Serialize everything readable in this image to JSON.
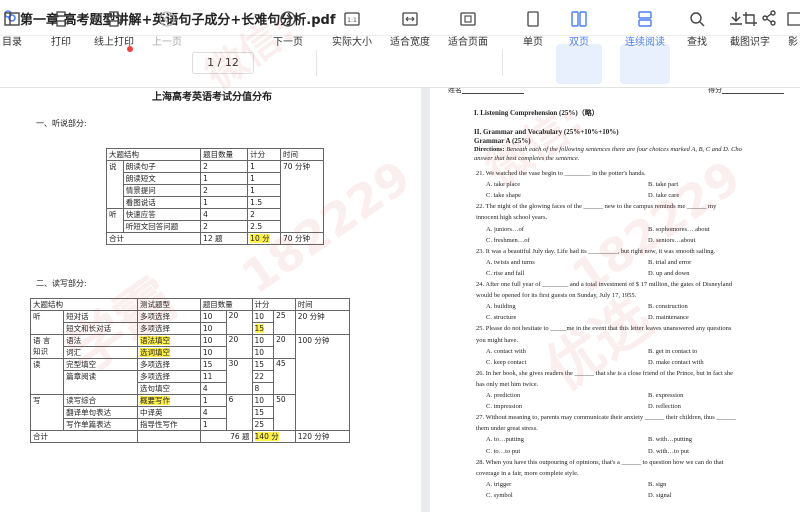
{
  "window": {
    "title": "第一章 高考题型讲解+英语句子成分+长难句分析.pdf"
  },
  "toolbar": {
    "items": [
      {
        "label": "目录",
        "icon": "sidebar-icon"
      },
      {
        "label": "打印",
        "icon": "printer-icon"
      },
      {
        "label": "线上打印",
        "icon": "cloud-printer-icon"
      },
      {
        "label": "上一页",
        "icon": "arrow-left-circle-icon"
      },
      {
        "label": "下一页",
        "icon": "arrow-right-circle-icon"
      },
      {
        "label": "实际大小",
        "icon": "actual-size-icon"
      },
      {
        "label": "适合宽度",
        "icon": "fit-width-icon"
      },
      {
        "label": "适合页面",
        "icon": "fit-page-icon"
      },
      {
        "label": "单页",
        "icon": "single-page-icon"
      },
      {
        "label": "双页",
        "icon": "double-page-icon"
      },
      {
        "label": "连续阅读",
        "icon": "continuous-read-icon"
      },
      {
        "label": "查找",
        "icon": "search-icon"
      },
      {
        "label": "截图识字",
        "icon": "screenshot-ocr-icon"
      },
      {
        "label": "影",
        "icon": "more-icon"
      }
    ],
    "current_page": "1",
    "page_sep": "/",
    "total_pages": "12"
  },
  "left_page": {
    "title": "上海高考英语考试分值分布",
    "section1": "一、听说部分:",
    "table1": {
      "header": [
        "大题结构",
        "",
        "题目数量",
        "计分",
        "时间"
      ],
      "rows": [
        [
          "说",
          "朗读句子",
          "2",
          "1",
          "70 分钟"
        ],
        [
          "",
          "朗读短文",
          "1",
          "1",
          ""
        ],
        [
          "",
          "情景提问",
          "2",
          "1",
          ""
        ],
        [
          "",
          "看图说话",
          "1",
          "1.5",
          ""
        ],
        [
          "听",
          "快速应答",
          "4",
          "2",
          ""
        ],
        [
          "",
          "听短文回答问题",
          "2",
          "2.5",
          ""
        ],
        [
          "合计",
          "",
          "12 题",
          "10 分",
          "70 分钟"
        ]
      ]
    },
    "section2": "二、读写部分:",
    "table2": {
      "header": [
        "大题结构",
        "测试题型",
        "题目数量",
        "",
        "计分",
        "",
        "时间"
      ],
      "rows": [
        [
          "听",
          "短对话",
          "多项选择",
          "10",
          "20",
          "10",
          "25",
          "20 分钟"
        ],
        [
          "",
          "短文和长对话",
          "多项选择",
          "10",
          "",
          "15",
          "",
          ""
        ],
        [
          "语 言",
          "语法",
          "语法填空",
          "10",
          "20",
          "10",
          "20",
          "100 分钟"
        ],
        [
          "知识",
          "词汇",
          "选词填空",
          "10",
          "",
          "10",
          "",
          ""
        ],
        [
          "读",
          "完型填空",
          "多项选择",
          "15",
          "30",
          "15",
          "45",
          ""
        ],
        [
          "",
          "篇章阅读",
          "多项选择",
          "11",
          "",
          "22",
          "",
          ""
        ],
        [
          "",
          "",
          "选句填空",
          "4",
          "",
          "8",
          "",
          ""
        ],
        [
          "写",
          "读写综合",
          "概要写作",
          "1",
          "6",
          "10",
          "50",
          ""
        ],
        [
          "",
          "翻译单句表达",
          "中译英",
          "4",
          "",
          "15",
          "",
          ""
        ],
        [
          "",
          "写作单篇表达",
          "指导性写作",
          "1",
          "",
          "25",
          "",
          ""
        ],
        [
          "合计",
          "",
          "",
          "",
          "76 题",
          "",
          "140 分",
          "120 分钟"
        ]
      ]
    }
  },
  "right_page": {
    "header_left": "姓名",
    "header_right": "得分",
    "part1": "I. Listening Comprehension (25%)（略）",
    "part2": "II. Grammar and Vocabulary (25%+10%+10%)",
    "grammar_a": "Grammar A (25%)",
    "directions_label": "Directions:",
    "directions": "Beneath each of the following sentences there are four choices marked A, B, C and D. Cho",
    "directions2": "answer that best completes the sentence.",
    "lines": [
      "21. We watched the vase begin to ________ in the potter's hands.",
      "A. take place|B. take part",
      "C. take shape|D. take care",
      "22.  The night of the glowing faces of the ______ new to the campus reminds me ______ my",
      "innocent high school years.",
      "A. juniors…of|B. sophomores… about",
      "C. freshmen…of|D. seniors…about",
      "23. It was a beautiful July day. Life had its _________, but right now, it was smooth sailing.",
      "A. twists and turns|B. trial and error",
      "C. rise and fall|D. up and down",
      "24. After one full year of ________ and a total investment of $ 17 million, the gates of Disneyland",
      "would be opened for its first guests on Sunday, July 17, 1955.",
      "A. building|B. construction",
      "C. structure|D. maintenance",
      "25. Please do not hesitate to _____me in the event that this letter leaves unanswered any questions",
      "you might have.",
      "A. contact with|B. get in contact to",
      "C. keep contact|D. make contact with",
      "26. In her book, she gives readers the ______ that she is a close friend of the Prince, but in fact she",
      "has only met him twice.",
      "A. prediction|B. expression",
      "C. impression|D. reflection",
      "27. Without meaning to, parents may communicate their anxiety ______ their children, thus ______",
      "them under great stress.",
      "A. to…putting|B. with…putting",
      "C. to…to put|D. with…to put",
      "28. When you have this outpouring of opinions, that's a ______ to question how we can do that",
      "coverage in a fair, more complete style.",
      "A. trigger|B. sign",
      "C. symbol|D. signal"
    ]
  },
  "watermark": {
    "a": "微信:",
    "b": "学霸",
    "c": "182229",
    "d": "优选"
  }
}
